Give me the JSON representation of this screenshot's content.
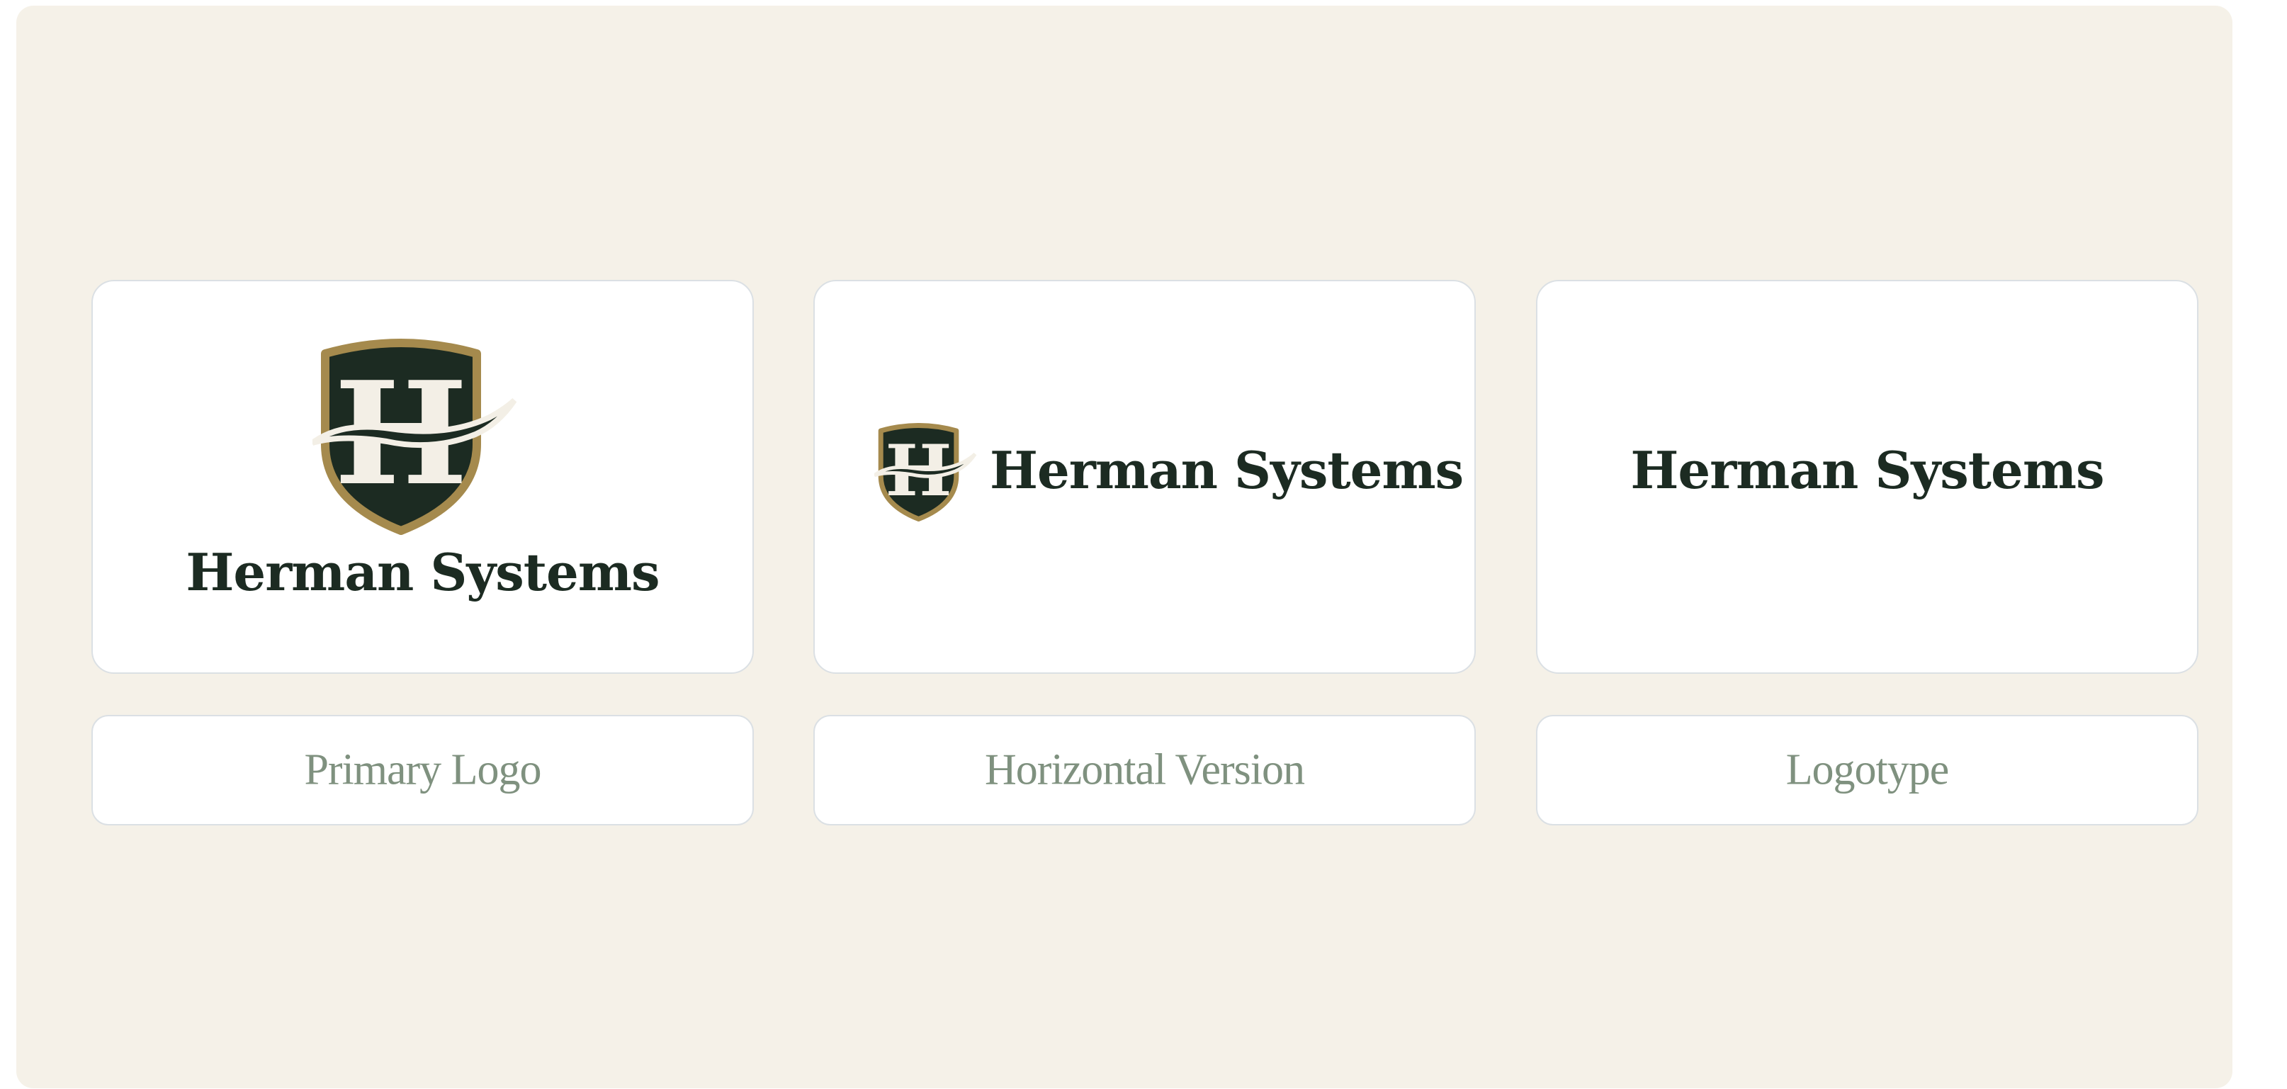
{
  "brand": {
    "name": "Herman Systems",
    "monogram": "H",
    "colors": {
      "background": "#f5f1e8",
      "card": "#ffffff",
      "card_border": "#dbe0e4",
      "shield_fill": "#1c2b22",
      "shield_border": "#a58a4d",
      "wordmark": "#1c2b22",
      "label_text": "#7f917f"
    }
  },
  "variants": [
    {
      "label": "Primary Logo",
      "wordmark": "Herman Systems",
      "icon": "shield-monogram-icon"
    },
    {
      "label": "Horizontal Version",
      "wordmark": "Herman Systems",
      "icon": "shield-monogram-icon"
    },
    {
      "label": "Logotype",
      "wordmark": "Herman Systems"
    }
  ]
}
